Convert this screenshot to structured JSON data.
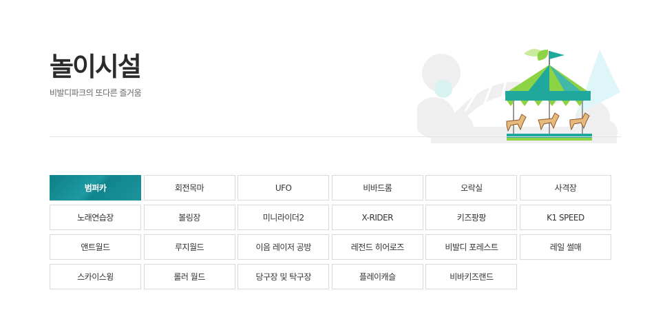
{
  "page": {
    "title": "놀이시설",
    "subtitle": "비발디파크의 또다른 즐거움"
  },
  "facilities": {
    "active_index": 0,
    "items": [
      "범퍼카",
      "회전목마",
      "UFO",
      "비바드롬",
      "오락실",
      "사격장",
      "노래연습장",
      "볼링장",
      "미니라이더2",
      "X-RIDER",
      "키즈팡팡",
      "K1 SPEED",
      "앤트월드",
      "루지월드",
      "이음 레이저 공방",
      "레전드 히어로즈",
      "비발디 포레스트",
      "레일 썰매",
      "스카이스윙",
      "롤러 월드",
      "당구장 및 탁구장",
      "플레이캐슬",
      "비바키즈랜드"
    ]
  },
  "colors": {
    "active_bg": "#148e96",
    "illustration_green": "#8dd444",
    "illustration_teal": "#1fa89b"
  },
  "icons": {
    "illustration": "carousel-illustration"
  }
}
